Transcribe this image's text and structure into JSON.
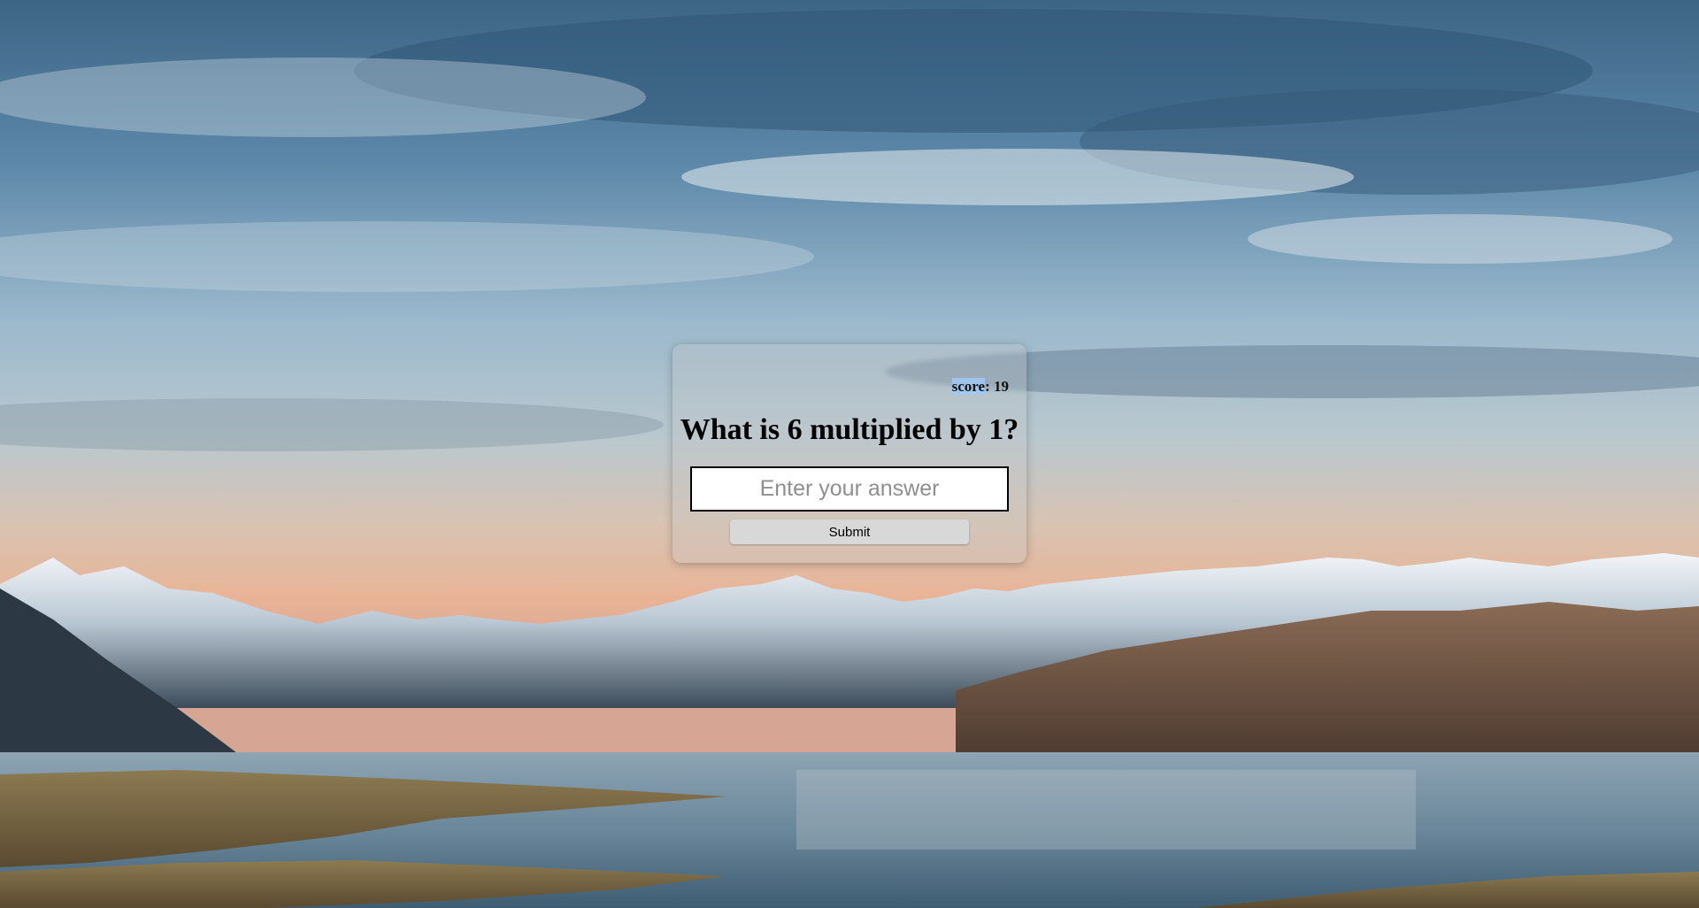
{
  "background": {
    "scene": "mountain-lake-landscape",
    "sky_color_top": "#3f6a8e",
    "sky_color_horizon": "#e7b79a",
    "mountain_snow_color": "#e8eef4",
    "lake_color": "#5f7d93"
  },
  "quiz": {
    "score_label": "score",
    "score_separator": ": ",
    "score_value": "19",
    "question": "What is 6 multiplied by 1?",
    "answer_value": "",
    "answer_placeholder": "Enter your answer",
    "submit_label": "Submit"
  }
}
